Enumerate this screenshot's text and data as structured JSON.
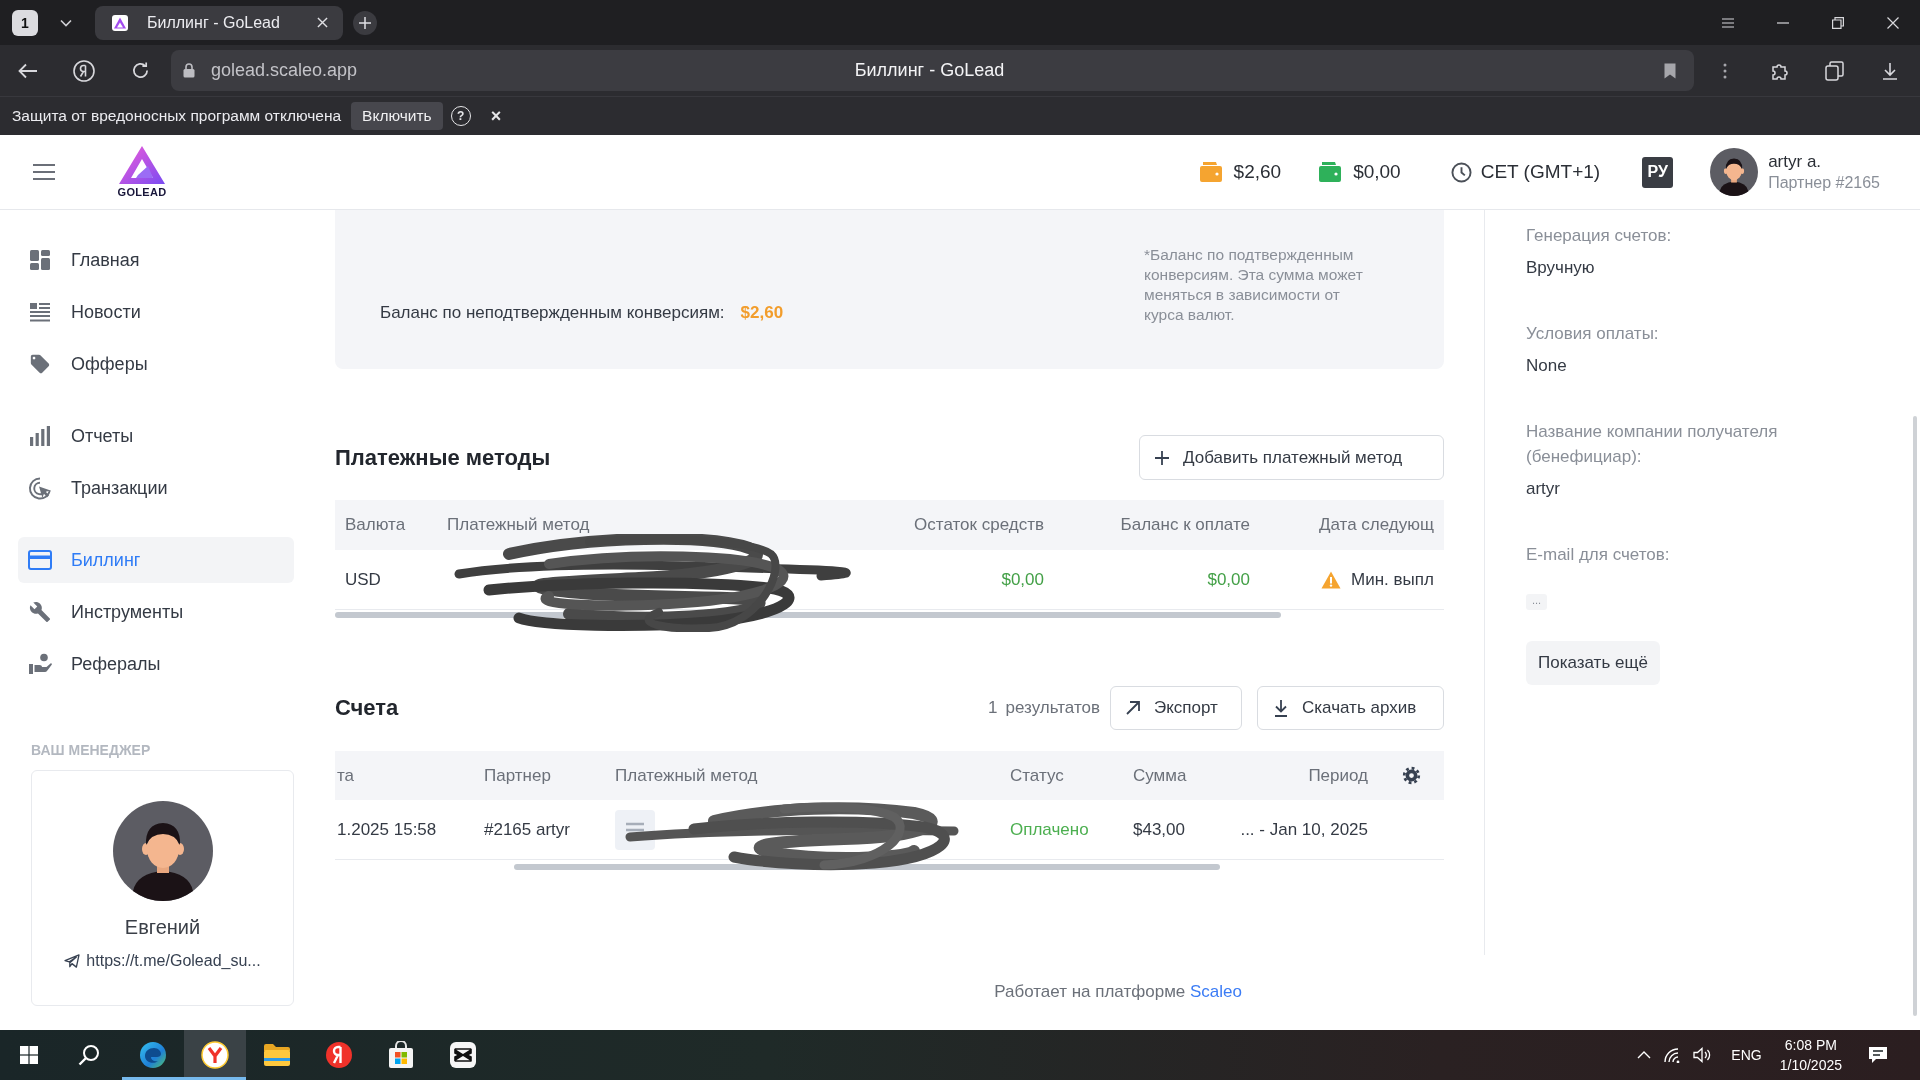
{
  "browser": {
    "tab_count": "1",
    "tab_title": "Биллинг - GoLead",
    "address": "golead.scaleo.app",
    "page_title": "Биллинг - GoLead",
    "notice": {
      "text": "Защита от вредоносных программ отключена",
      "button": "Включить",
      "help": "?",
      "close": "×"
    }
  },
  "header": {
    "logo_text": "GOLEAD",
    "balances": [
      {
        "amount": "$2,60",
        "color": "#f5a430"
      },
      {
        "amount": "$0,00",
        "color": "#2eb15a"
      }
    ],
    "timezone": "CET (GMT+1)",
    "language": "РУ",
    "user": {
      "name": "artyr a.",
      "role": "Партнер #2165"
    }
  },
  "sidebar": {
    "groups": [
      {
        "items": [
          {
            "label": "Главная",
            "selected": false
          },
          {
            "label": "Новости",
            "selected": false
          },
          {
            "label": "Офферы",
            "selected": false
          }
        ]
      },
      {
        "items": [
          {
            "label": "Отчеты",
            "selected": false
          },
          {
            "label": "Транзакции",
            "selected": false
          }
        ]
      },
      {
        "items": [
          {
            "label": "Биллинг",
            "selected": true
          },
          {
            "label": "Инструменты",
            "selected": false
          },
          {
            "label": "Рефералы",
            "selected": false
          }
        ]
      }
    ],
    "manager": {
      "heading": "ВАШ МЕНЕДЖЕР",
      "name": "Евгений",
      "link": "https://t.me/Golead_su..."
    }
  },
  "balance_card": {
    "label": "Баланс по неподтвержденным конверсиям:",
    "amount": "$2,60",
    "note": "*Баланс по подтвержденным конверсиям. Эта сумма может меняться в зависимости от курса валют."
  },
  "payment_methods": {
    "title": "Платежные методы",
    "add_button": "Добавить платежный метод",
    "columns": [
      "Валюта",
      "Платежный метод",
      "Остаток средств",
      "Баланс к оплате",
      "Дата следующ"
    ],
    "rows": [
      {
        "currency": "USD",
        "balance": "$0,00",
        "payable": "$0,00",
        "next_payout": "Мин. выпл",
        "warning": true
      }
    ]
  },
  "invoices": {
    "title": "Счета",
    "result_count": "1",
    "result_label": "результатов",
    "export_button": "Экспорт",
    "download_button": "Скачать архив",
    "columns": [
      "та",
      "Партнер",
      "Платежный метод",
      "Статус",
      "Сумма",
      "Период"
    ],
    "rows": [
      {
        "date": "1.2025 15:58",
        "partner": "#2165 artyr",
        "status": "Оплачено",
        "amount": "$43,00",
        "period": "... - Jan 10, 2025"
      }
    ]
  },
  "details_panel": {
    "fields": [
      {
        "label": "Генерация счетов:",
        "value": "Вручную",
        "kind": "text"
      },
      {
        "label": "Условия оплаты:",
        "value": "None",
        "kind": "text"
      },
      {
        "label": "Название компании получателя (бенефициар):",
        "value": "artyr",
        "kind": "text"
      },
      {
        "label": "E-mail для счетов:",
        "value": "...",
        "kind": "tag"
      }
    ],
    "show_more_button": "Показать ещё"
  },
  "footer": {
    "text": "Работает на платформе",
    "link": "Scaleo"
  },
  "taskbar": {
    "apps": [
      {
        "running": true,
        "selected": false
      },
      {
        "running": true,
        "selected": true
      },
      {
        "running": false,
        "selected": false
      },
      {
        "running": false,
        "selected": false
      },
      {
        "running": false,
        "selected": false
      },
      {
        "running": false,
        "selected": false
      }
    ],
    "language": "ENG",
    "time": "6:08 PM",
    "date": "1/10/2025"
  }
}
